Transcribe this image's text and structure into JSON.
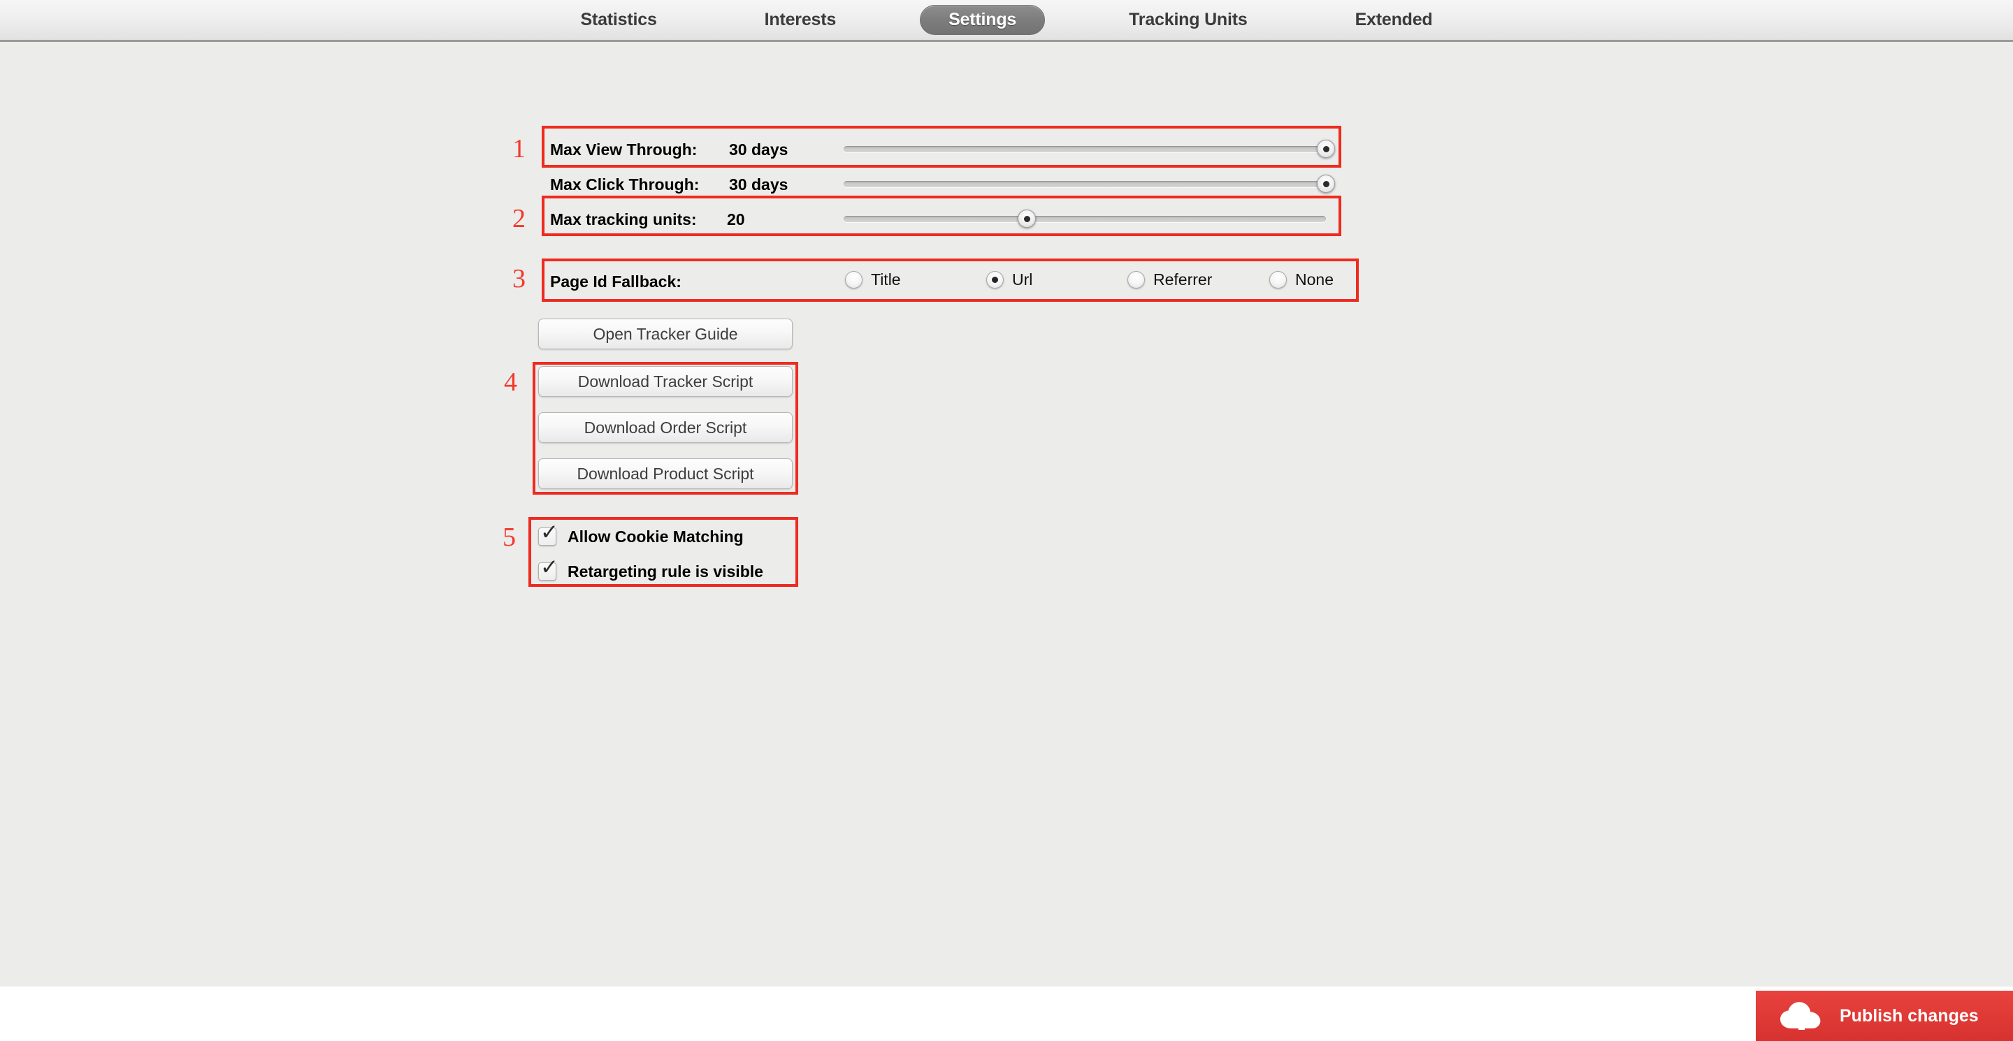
{
  "tabs": [
    {
      "label": "Statistics",
      "active": false
    },
    {
      "label": "Interests",
      "active": false
    },
    {
      "label": "Settings",
      "active": true
    },
    {
      "label": "Tracking Units",
      "active": false
    },
    {
      "label": "Extended",
      "active": false
    }
  ],
  "annotations": [
    {
      "number": "1"
    },
    {
      "number": "2"
    },
    {
      "number": "3"
    },
    {
      "number": "4"
    },
    {
      "number": "5"
    }
  ],
  "sliders": [
    {
      "label": "Max View Through:",
      "value": "30 days",
      "percent": 100
    },
    {
      "label": "Max Click Through:",
      "value": "30 days",
      "percent": 100
    },
    {
      "label": "Max tracking units:",
      "value": "20",
      "percent": 38
    }
  ],
  "page_id_fallback": {
    "label": "Page Id Fallback:",
    "options": [
      {
        "label": "Title",
        "selected": false
      },
      {
        "label": "Url",
        "selected": true
      },
      {
        "label": "Referrer",
        "selected": false
      },
      {
        "label": "None",
        "selected": false
      }
    ]
  },
  "buttons": {
    "guide": "Open Tracker Guide",
    "downloads": [
      "Download Tracker Script",
      "Download Order Script",
      "Download Product Script"
    ]
  },
  "checkboxes": [
    {
      "label": "Allow Cookie Matching",
      "checked": true
    },
    {
      "label": "Retargeting rule is visible",
      "checked": true
    }
  ],
  "publish": {
    "label": "Publish changes",
    "icon": "cloud-upload-icon",
    "color": "#e03a36"
  }
}
